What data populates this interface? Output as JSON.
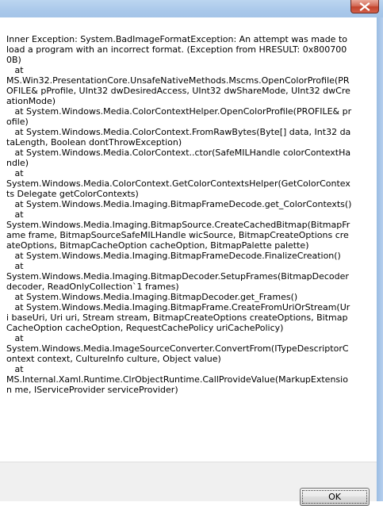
{
  "window": {
    "close_icon": "close-x-icon"
  },
  "message": {
    "text": "Inner Exception: System.BadImageFormatException: An attempt was made to load a program with an incorrect format. (Exception from HRESULT: 0x8007000B)\n   at\nMS.Win32.PresentationCore.UnsafeNativeMethods.Mscms.OpenColorProfile(PROFILE& pProfile, UInt32 dwDesiredAccess, UInt32 dwShareMode, UInt32 dwCreationMode)\n   at System.Windows.Media.ColorContextHelper.OpenColorProfile(PROFILE& profile)\n   at System.Windows.Media.ColorContext.FromRawBytes(Byte[] data, Int32 dataLength, Boolean dontThrowException)\n   at System.Windows.Media.ColorContext..ctor(SafeMILHandle colorContextHandle)\n   at\nSystem.Windows.Media.ColorContext.GetColorContextsHelper(GetColorContexts Delegate getColorContexts)\n   at System.Windows.Media.Imaging.BitmapFrameDecode.get_ColorContexts()\n   at\nSystem.Windows.Media.Imaging.BitmapSource.CreateCachedBitmap(BitmapFrame frame, BitmapSourceSafeMILHandle wicSource, BitmapCreateOptions createOptions, BitmapCacheOption cacheOption, BitmapPalette palette)\n   at System.Windows.Media.Imaging.BitmapFrameDecode.FinalizeCreation()\n   at\nSystem.Windows.Media.Imaging.BitmapDecoder.SetupFrames(BitmapDecoder decoder, ReadOnlyCollection`1 frames)\n   at System.Windows.Media.Imaging.BitmapDecoder.get_Frames()\n   at System.Windows.Media.Imaging.BitmapFrame.CreateFromUriOrStream(Uri baseUri, Uri uri, Stream stream, BitmapCreateOptions createOptions, BitmapCacheOption cacheOption, RequestCachePolicy uriCachePolicy)\n   at\nSystem.Windows.Media.ImageSourceConverter.ConvertFrom(ITypeDescriptorContext context, CultureInfo culture, Object value)\n   at\nMS.Internal.Xaml.Runtime.ClrObjectRuntime.CallProvideValue(MarkupExtension me, IServiceProvider serviceProvider)"
  },
  "footer": {
    "ok_label": "OK"
  }
}
